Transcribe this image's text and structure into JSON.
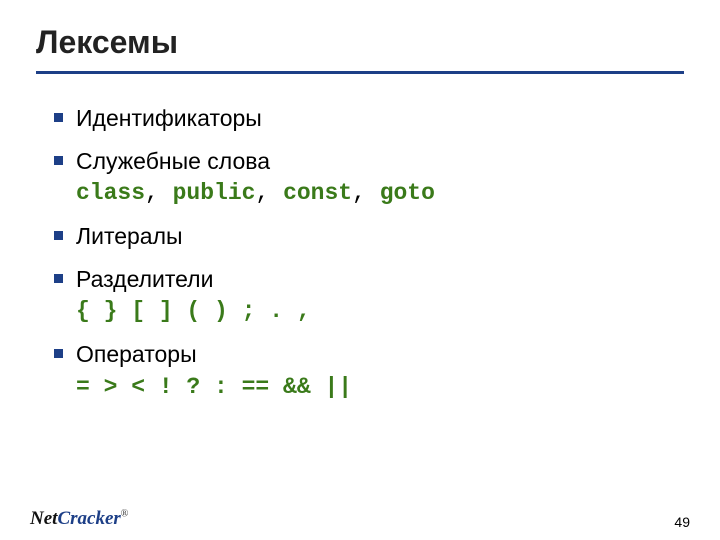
{
  "title": "Лексемы",
  "bullets": {
    "b0": {
      "label": "Идентификаторы"
    },
    "b1": {
      "label": "Служебные слова",
      "kw0": "class",
      "s0": ", ",
      "kw1": "public",
      "s1": ", ",
      "kw2": "const",
      "s2": ", ",
      "kw3": "goto"
    },
    "b2": {
      "label": "Литералы"
    },
    "b3": {
      "label": "Разделители",
      "code": "{ } [ ] ( ) ; . ,"
    },
    "b4": {
      "label": "Операторы",
      "code": "= > < ! ? : == && ||"
    }
  },
  "footer": {
    "logo_net": "Net",
    "logo_cracker": "Cracker",
    "reg": "®",
    "page": "49"
  }
}
